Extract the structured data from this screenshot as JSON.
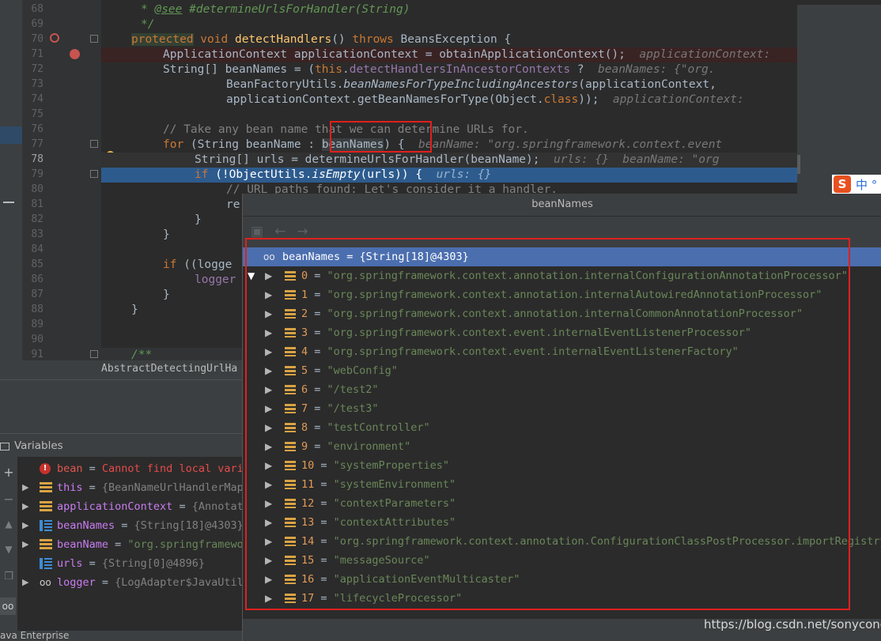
{
  "editor": {
    "lines": [
      "68",
      "69",
      "70",
      "71",
      "72",
      "73",
      "74",
      "75",
      "76",
      "77",
      "78",
      "79",
      "80",
      "81",
      "82",
      "83",
      "84",
      "85",
      "86",
      "87",
      "88",
      "89",
      "90",
      "91"
    ],
    "current_line": "78",
    "code": {
      "l68a": "* ",
      "l68b": "@see",
      "l68c": " #determineUrlsForHandler(String)",
      "l69": "*/",
      "l70a": "protected",
      "l70b": " void ",
      "l70c": "detectHandlers",
      "l70d": "() ",
      "l70e": "throws",
      "l70f": " BeansException {",
      "l71a": "ApplicationContext applicationContext = obtainApplicationContext();",
      "l71b": "  applicationContext:",
      "l72a": "String[] beanNames = (",
      "l72b": "this",
      "l72c": ".",
      "l72d": "detectHandlersInAncestorContexts",
      "l72e": " ?",
      "l72f": "  beanNames: {\"org.",
      "l73a": "BeanFactoryUtils.",
      "l73b": "beanNamesForTypeIncludingAncestors",
      "l73c": "(applicationContext,",
      "l74a": "applicationContext.getBeanNamesForType(Object.",
      "l74b": "class",
      "l74c": "));",
      "l74d": "  applicationContext:",
      "l76": "// Take any bean name that we can determine URLs for.",
      "l77a": "for",
      "l77b": " (String beanName : ",
      "l77c": "beanNames",
      "l77d": ") {",
      "l77e": "  beanName: \"org.springframework.context.event",
      "l78a": "String[] urls = determineUrlsForHandler(beanName);",
      "l78b": "  urls: {}  beanName: \"org",
      "l79a": "if",
      "l79b": " (!ObjectUtils.",
      "l79c": "isEmpty",
      "l79d": "(urls)) {",
      "l79e": "  urls: {}",
      "l80": "// URL paths found: Let's consider it a handler.",
      "l81": "re",
      "l82": "}",
      "l83": "}",
      "l85a": "if",
      "l85b": " ((logge",
      "l86": "logger",
      "l87": "}",
      "l88": "}",
      "l91": "/**"
    },
    "breadcrumb": "AbstractDetectingUrlHa"
  },
  "ime": {
    "logo": "S",
    "text": "中 °"
  },
  "variables": {
    "title": "Variables",
    "items": [
      {
        "name": "bean",
        "eq": " = ",
        "value": "Cannot find local vari",
        "kind": "error"
      },
      {
        "name": "this",
        "eq": " = ",
        "value": "{BeanNameUrlHandlerMap",
        "kind": "field"
      },
      {
        "name": "applicationContext",
        "eq": " = ",
        "value": "{Annotat",
        "kind": "field"
      },
      {
        "name": "beanNames",
        "eq": " = ",
        "value": "{String[18]@4303}",
        "kind": "array"
      },
      {
        "name": "beanName",
        "eq": " = ",
        "value": "\"org.springframewo",
        "kind": "field"
      },
      {
        "name": "urls",
        "eq": " = ",
        "value": "{String[0]@4896}",
        "kind": "array"
      },
      {
        "name": "logger",
        "eq": " = ",
        "value": "{LogAdapter$JavaUtil",
        "kind": "watch"
      }
    ]
  },
  "status": "ava Enterprise",
  "popup": {
    "title": "beanNames",
    "root": {
      "name": "beanNames",
      "eq": " = ",
      "value": "{String[18]@4303}"
    },
    "items": [
      {
        "idx": "0",
        "val": "\"org.springframework.context.annotation.internalConfigurationAnnotationProcessor\""
      },
      {
        "idx": "1",
        "val": "\"org.springframework.context.annotation.internalAutowiredAnnotationProcessor\""
      },
      {
        "idx": "2",
        "val": "\"org.springframework.context.annotation.internalCommonAnnotationProcessor\""
      },
      {
        "idx": "3",
        "val": "\"org.springframework.context.event.internalEventListenerProcessor\""
      },
      {
        "idx": "4",
        "val": "\"org.springframework.context.event.internalEventListenerFactory\""
      },
      {
        "idx": "5",
        "val": "\"webConfig\""
      },
      {
        "idx": "6",
        "val": "\"/test2\""
      },
      {
        "idx": "7",
        "val": "\"/test3\""
      },
      {
        "idx": "8",
        "val": "\"testController\""
      },
      {
        "idx": "9",
        "val": "\"environment\""
      },
      {
        "idx": "10",
        "val": "\"systemProperties\""
      },
      {
        "idx": "11",
        "val": "\"systemEnvironment\""
      },
      {
        "idx": "12",
        "val": "\"contextParameters\""
      },
      {
        "idx": "13",
        "val": "\"contextAttributes\""
      },
      {
        "idx": "14",
        "val": "\"org.springframework.context.annotation.ConfigurationClassPostProcessor.importRegistry\""
      },
      {
        "idx": "15",
        "val": "\"messageSource\""
      },
      {
        "idx": "16",
        "val": "\"applicationEventMulticaster\""
      },
      {
        "idx": "17",
        "val": "\"lifecycleProcessor\""
      }
    ]
  },
  "watermark": "https://blog.csdn.net/sonycong"
}
